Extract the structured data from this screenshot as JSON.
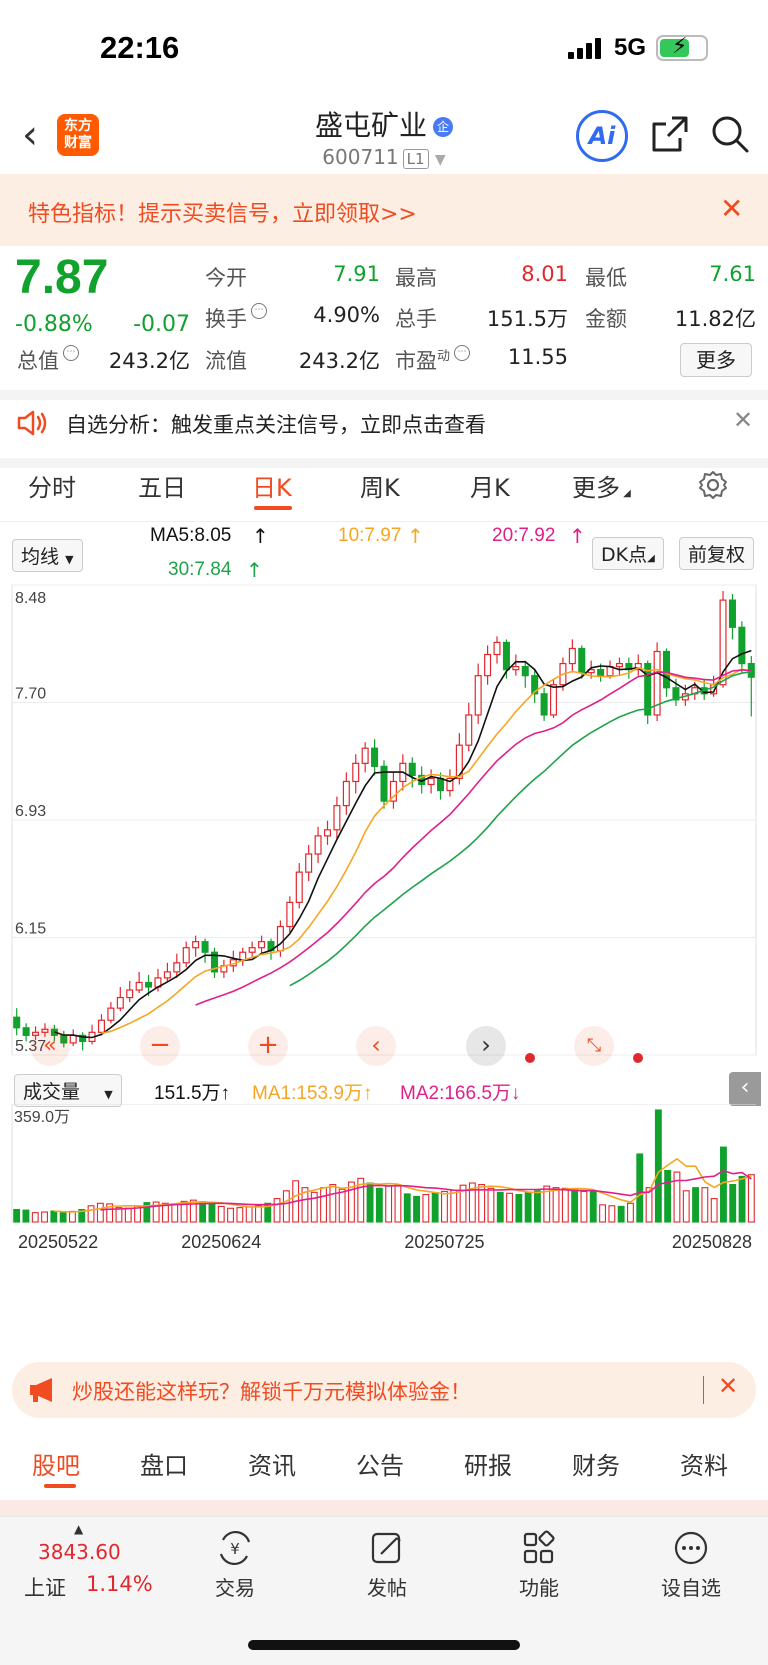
{
  "status_bar": {
    "time": "22:16",
    "network": "5G"
  },
  "header": {
    "logo_line1": "东方",
    "logo_line2": "财富",
    "stock_name": "盛屯矿业",
    "stock_badge": "企",
    "stock_code": "600711",
    "level": "L1",
    "ai_label": "Ai"
  },
  "promo_banner": {
    "text": "特色指标！提示买卖信号，立即领取>>"
  },
  "quote": {
    "price": "7.87",
    "change_pct": "-0.88%",
    "change": "-0.07",
    "open_label": "今开",
    "open": "7.91",
    "high_label": "最高",
    "high": "8.01",
    "low_label": "最低",
    "low": "7.61",
    "turnover_label": "换手",
    "turnover": "4.90%",
    "volume_label": "总手",
    "volume": "151.5万",
    "amount_label": "金额",
    "amount": "11.82亿",
    "mktcap_label": "总值",
    "mktcap": "243.2亿",
    "float_label": "流值",
    "float_cap": "243.2亿",
    "pe_label": "市盈",
    "pe_sup": "动",
    "pe": "11.55",
    "more_label": "更多"
  },
  "notice": {
    "text": "自选分析：触发重点关注信号，立即点击查看"
  },
  "chart_tabs": [
    "分时",
    "五日",
    "日K",
    "周K",
    "月K",
    "更多"
  ],
  "kline_header": {
    "indicator_select": "均线",
    "ma5": "MA5:8.05",
    "ma10": "10:7.97",
    "ma20": "20:7.92",
    "ma30": "30:7.84",
    "dk_label": "DK点",
    "adjust_label": "前复权"
  },
  "volume_header": {
    "select": "成交量",
    "vol": "151.5万",
    "ma1": "MA1:153.9万",
    "ma2": "MA2:166.5万",
    "ymax": "359.0万"
  },
  "colors": {
    "up": "#e0282e",
    "down": "#11a12d",
    "ma5": "#111111",
    "ma10": "#f5a623",
    "ma20": "#e0208a",
    "ma30": "#1fa34a",
    "accent": "#f04b21"
  },
  "chart_data": [
    {
      "type": "candlestick",
      "y_ticks": [
        "8.48",
        "7.70",
        "6.93",
        "6.15",
        "5.37"
      ],
      "ylim": [
        5.37,
        8.48
      ],
      "series": [
        {
          "values": [
            [
              5.62,
              5.55,
              5.68,
              5.5
            ],
            [
              5.55,
              5.5,
              5.58,
              5.46
            ],
            [
              5.5,
              5.52,
              5.56,
              5.47
            ],
            [
              5.52,
              5.54,
              5.58,
              5.49
            ],
            [
              5.54,
              5.5,
              5.57,
              5.46
            ],
            [
              5.5,
              5.45,
              5.53,
              5.42
            ],
            [
              5.45,
              5.5,
              5.54,
              5.43
            ],
            [
              5.5,
              5.46,
              5.52,
              5.4
            ],
            [
              5.46,
              5.52,
              5.57,
              5.44
            ],
            [
              5.52,
              5.6,
              5.64,
              5.5
            ],
            [
              5.6,
              5.68,
              5.72,
              5.58
            ],
            [
              5.68,
              5.75,
              5.82,
              5.66
            ],
            [
              5.75,
              5.8,
              5.86,
              5.72
            ],
            [
              5.8,
              5.85,
              5.92,
              5.78
            ],
            [
              5.85,
              5.82,
              5.9,
              5.76
            ],
            [
              5.82,
              5.88,
              5.94,
              5.79
            ],
            [
              5.88,
              5.92,
              5.98,
              5.85
            ],
            [
              5.92,
              5.98,
              6.04,
              5.88
            ],
            [
              5.98,
              6.08,
              6.12,
              5.95
            ],
            [
              6.08,
              6.12,
              6.16,
              6.02
            ],
            [
              6.12,
              6.05,
              6.14,
              5.98
            ],
            [
              6.05,
              5.92,
              6.08,
              5.88
            ],
            [
              5.92,
              5.96,
              6.0,
              5.88
            ],
            [
              5.96,
              6.0,
              6.06,
              5.92
            ],
            [
              6.0,
              6.05,
              6.08,
              5.96
            ],
            [
              6.05,
              6.08,
              6.12,
              6.02
            ],
            [
              6.08,
              6.12,
              6.16,
              6.04
            ],
            [
              6.12,
              6.06,
              6.14,
              6.0
            ],
            [
              6.06,
              6.22,
              6.26,
              6.02
            ],
            [
              6.22,
              6.38,
              6.42,
              6.18
            ],
            [
              6.38,
              6.58,
              6.64,
              6.34
            ],
            [
              6.58,
              6.7,
              6.76,
              6.52
            ],
            [
              6.7,
              6.82,
              6.88,
              6.64
            ],
            [
              6.82,
              6.86,
              6.92,
              6.76
            ],
            [
              6.86,
              7.02,
              7.08,
              6.8
            ],
            [
              7.02,
              7.18,
              7.24,
              6.96
            ],
            [
              7.18,
              7.3,
              7.36,
              7.1
            ],
            [
              7.3,
              7.4,
              7.44,
              7.24
            ],
            [
              7.4,
              7.28,
              7.46,
              7.22
            ],
            [
              7.28,
              7.05,
              7.32,
              7.0
            ],
            [
              7.05,
              7.18,
              7.24,
              7.0
            ],
            [
              7.18,
              7.3,
              7.36,
              7.12
            ],
            [
              7.3,
              7.22,
              7.34,
              7.14
            ],
            [
              7.22,
              7.16,
              7.28,
              7.1
            ],
            [
              7.16,
              7.2,
              7.26,
              7.1
            ],
            [
              7.2,
              7.12,
              7.24,
              7.06
            ],
            [
              7.12,
              7.2,
              7.26,
              7.08
            ],
            [
              7.2,
              7.42,
              7.5,
              7.16
            ],
            [
              7.42,
              7.62,
              7.7,
              7.38
            ],
            [
              7.62,
              7.88,
              7.96,
              7.56
            ],
            [
              7.88,
              8.02,
              8.08,
              7.82
            ],
            [
              8.02,
              8.1,
              8.14,
              7.96
            ],
            [
              8.1,
              7.92,
              8.12,
              7.86
            ],
            [
              7.92,
              7.94,
              8.02,
              7.88
            ],
            [
              7.94,
              7.88,
              7.98,
              7.8
            ],
            [
              7.88,
              7.76,
              7.92,
              7.7
            ],
            [
              7.76,
              7.62,
              7.8,
              7.58
            ],
            [
              7.62,
              7.82,
              7.86,
              7.6
            ],
            [
              7.82,
              7.96,
              8.0,
              7.78
            ],
            [
              7.96,
              8.06,
              8.12,
              7.9
            ],
            [
              8.06,
              7.9,
              8.08,
              7.86
            ],
            [
              7.9,
              7.92,
              7.98,
              7.86
            ],
            [
              7.92,
              7.88,
              7.96,
              7.84
            ],
            [
              7.88,
              7.94,
              7.98,
              7.86
            ],
            [
              7.94,
              7.96,
              8.0,
              7.88
            ],
            [
              7.96,
              7.92,
              8.0,
              7.86
            ],
            [
              7.92,
              7.96,
              8.02,
              7.88
            ],
            [
              7.96,
              7.62,
              7.98,
              7.56
            ],
            [
              7.62,
              8.04,
              8.1,
              7.58
            ],
            [
              8.04,
              7.8,
              8.06,
              7.74
            ],
            [
              7.8,
              7.72,
              7.86,
              7.68
            ],
            [
              7.72,
              7.76,
              7.82,
              7.68
            ],
            [
              7.76,
              7.8,
              7.84,
              7.72
            ],
            [
              7.8,
              7.76,
              7.86,
              7.72
            ],
            [
              7.76,
              7.82,
              7.88,
              7.74
            ],
            [
              7.82,
              8.38,
              8.44,
              7.8
            ],
            [
              8.38,
              8.2,
              8.42,
              8.12
            ],
            [
              8.2,
              7.96,
              8.24,
              7.9
            ],
            [
              7.96,
              7.87,
              8.01,
              7.61
            ]
          ]
        }
      ]
    },
    {
      "type": "bar",
      "x_ticks": [
        "20250522",
        "20250624",
        "20250725",
        "20250828"
      ],
      "ymax": 359.0,
      "series": [
        {
          "values": [
            40,
            38,
            30,
            32,
            35,
            30,
            34,
            40,
            52,
            60,
            58,
            46,
            44,
            50,
            62,
            64,
            60,
            58,
            66,
            70,
            65,
            56,
            50,
            44,
            46,
            48,
            52,
            60,
            75,
            100,
            132,
            110,
            95,
            110,
            120,
            105,
            128,
            140,
            125,
            108,
            115,
            118,
            90,
            82,
            88,
            94,
            98,
            102,
            118,
            125,
            120,
            108,
            95,
            92,
            88,
            96,
            100,
            115,
            110,
            108,
            102,
            98,
            100,
            55,
            52,
            50,
            60,
            218,
            110,
            359,
            165,
            160,
            100,
            110,
            110,
            75,
            240,
            120,
            146,
            151.5
          ]
        }
      ]
    }
  ],
  "promo_banner2": {
    "text": "炒股还能这样玩？解锁千万元模拟体验金！"
  },
  "bottom_tabs": [
    "股吧",
    "盘口",
    "资讯",
    "公告",
    "研报",
    "财务",
    "资料"
  ],
  "bottom_bar": {
    "index_value": "3843.60",
    "index_name": "上证",
    "index_pct": "1.14%",
    "items": [
      "交易",
      "发帖",
      "功能",
      "设自选"
    ]
  }
}
